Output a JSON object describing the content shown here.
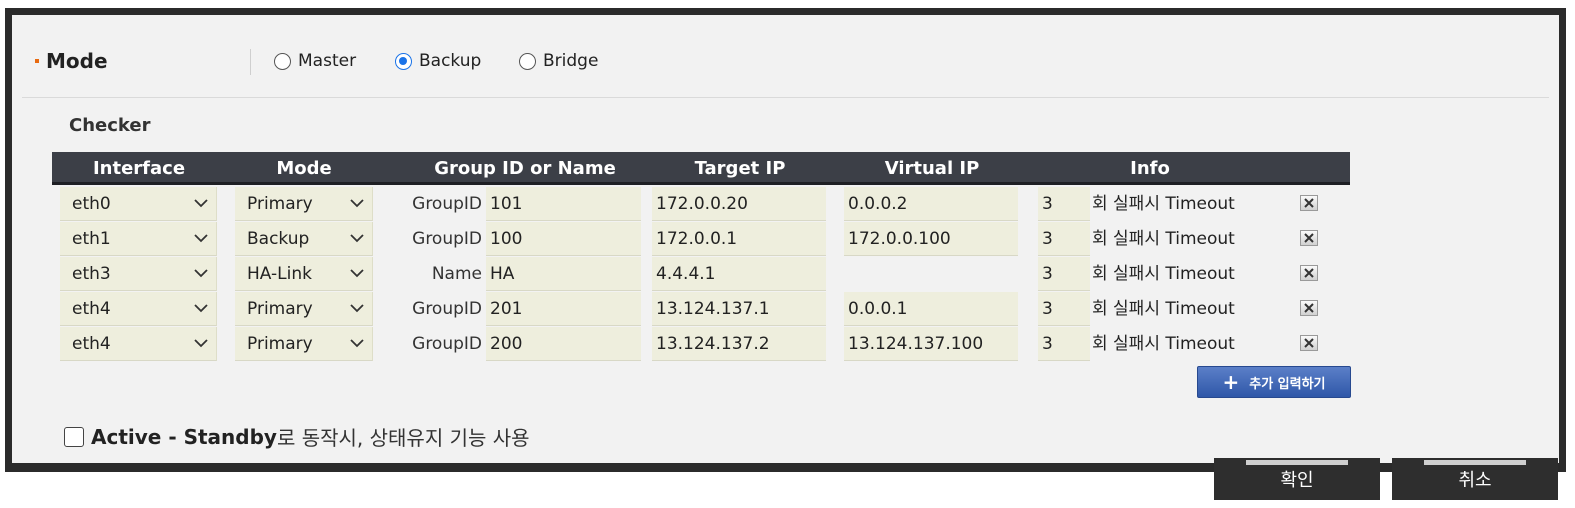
{
  "mode": {
    "title": "Mode",
    "options": [
      {
        "label": "Master",
        "selected": false
      },
      {
        "label": "Backup",
        "selected": true
      },
      {
        "label": "Bridge",
        "selected": false
      }
    ]
  },
  "checker": {
    "title": "Checker",
    "headers": [
      "Interface",
      "Mode",
      "Group ID or Name",
      "Target IP",
      "Virtual IP",
      "Info"
    ],
    "rows": [
      {
        "interface": "eth0",
        "mode": "Primary",
        "id_label": "GroupID",
        "id_value": "101",
        "target_ip": "172.0.0.20",
        "virtual_ip": "0.0.0.2",
        "fail_count": "3",
        "info_text": "회 실패시 Timeout"
      },
      {
        "interface": "eth1",
        "mode": "Backup",
        "id_label": "GroupID",
        "id_value": "100",
        "target_ip": "172.0.0.1",
        "virtual_ip": "172.0.0.100",
        "fail_count": "3",
        "info_text": "회 실패시 Timeout"
      },
      {
        "interface": "eth3",
        "mode": "HA-Link",
        "id_label": "Name",
        "id_value": "HA",
        "target_ip": "4.4.4.1",
        "virtual_ip": "",
        "fail_count": "3",
        "info_text": "회 실패시 Timeout"
      },
      {
        "interface": "eth4",
        "mode": "Primary",
        "id_label": "GroupID",
        "id_value": "201",
        "target_ip": "13.124.137.1",
        "virtual_ip": "0.0.0.1",
        "fail_count": "3",
        "info_text": "회 실패시 Timeout"
      },
      {
        "interface": "eth4",
        "mode": "Primary",
        "id_label": "GroupID",
        "id_value": "200",
        "target_ip": "13.124.137.2",
        "virtual_ip": "13.124.137.100",
        "fail_count": "3",
        "info_text": "회 실패시 Timeout"
      }
    ],
    "add_button": "추가 입력하기"
  },
  "active_standby": {
    "checked": false,
    "label_bold": "Active - Standby",
    "label_rest": "로 동작시, 상태유지 기능 사용"
  },
  "footer": {
    "confirm": "확인",
    "cancel": "취소"
  },
  "colors": {
    "header_bg": "#3c3f47",
    "input_bg": "#eeeedd",
    "accent_bullet": "#e86a10",
    "radio_selected": "#1a73e8",
    "add_button": "#3a62b3"
  },
  "icons": {
    "dropdown": "chevron-down-icon",
    "delete": "close-icon",
    "add": "plus-icon"
  }
}
